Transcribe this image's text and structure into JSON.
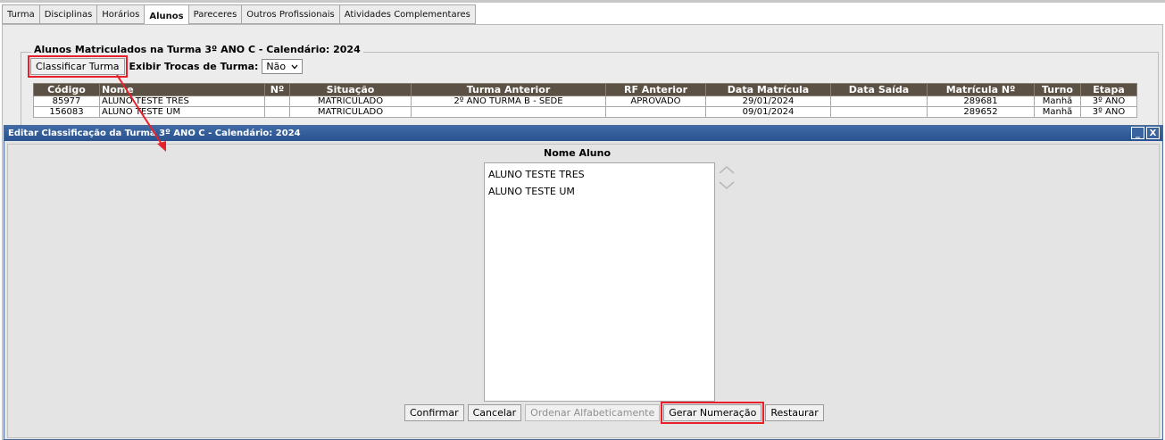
{
  "tabs": [
    "Turma",
    "Disciplinas",
    "Horários",
    "Alunos",
    "Pareceres",
    "Outros Profissionais",
    "Atividades Complementares"
  ],
  "active_tab": "Alunos",
  "section_title": "Alunos Matriculados na Turma 3º ANO C - Calendário: 2024",
  "classificar_label": "Classificar Turma",
  "exibir_label": "Exibir Trocas de Turma:",
  "exibir_value": "Não",
  "table": {
    "headers": [
      "Código",
      "Nome",
      "Nº",
      "Situação",
      "Turma Anterior",
      "RF Anterior",
      "Data Matrícula",
      "Data Saída",
      "Matrícula Nº",
      "Turno",
      "Etapa"
    ],
    "rows": [
      [
        "85977",
        "ALUNO TESTE TRÊS",
        "",
        "MATRICULADO",
        "2º ANO TURMA B - SEDE",
        "APROVADO",
        "29/01/2024",
        "",
        "289681",
        "Manhã",
        "3º ANO"
      ],
      [
        "156083",
        "ALUNO TESTE UM",
        "",
        "MATRICULADO",
        "",
        "",
        "09/01/2024",
        "",
        "289652",
        "Manhã",
        "3º ANO"
      ]
    ]
  },
  "modal": {
    "title": "Editar Classificação da Turma 3º ANO C - Calendário: 2024",
    "column_header": "Nome Aluno",
    "list": [
      "ALUNO TESTE TRES",
      "ALUNO TESTE UM"
    ],
    "buttons": {
      "confirmar": "Confirmar",
      "cancelar": "Cancelar",
      "ordenar": "Ordenar Alfabeticamente",
      "gerar": "Gerar Numeração",
      "restaurar": "Restaurar"
    },
    "minimize_glyph": "_",
    "close_glyph": "X"
  },
  "colors": {
    "header_bg": "#5b5145",
    "title_bar": "#2f5a96",
    "highlight": "#e8202a"
  }
}
